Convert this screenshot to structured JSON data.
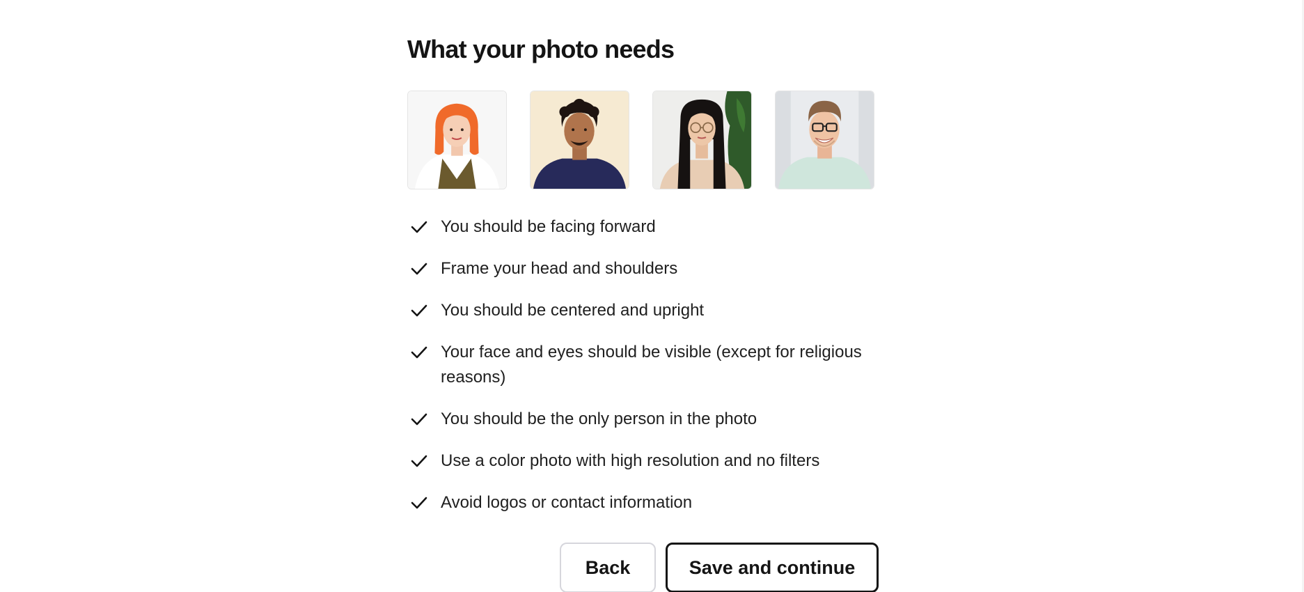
{
  "heading": "What your photo needs",
  "example_photos": [
    {
      "icon": "example-photo-woman-orange-hair"
    },
    {
      "icon": "example-photo-man-curly-hair"
    },
    {
      "icon": "example-photo-woman-glasses"
    },
    {
      "icon": "example-photo-man-glasses"
    }
  ],
  "requirements": [
    "You should be facing forward",
    "Frame your head and shoulders",
    "You should be centered and upright",
    "Your face and eyes should be visible (except for religious reasons)",
    "You should be the only person in the photo",
    "Use a color photo with high resolution and no filters",
    "Avoid logos or contact information"
  ],
  "buttons": {
    "back": "Back",
    "save": "Save and continue"
  },
  "colors": {
    "text": "#141414",
    "button_border_secondary": "#d6d6dc",
    "button_border_primary": "#141414"
  }
}
